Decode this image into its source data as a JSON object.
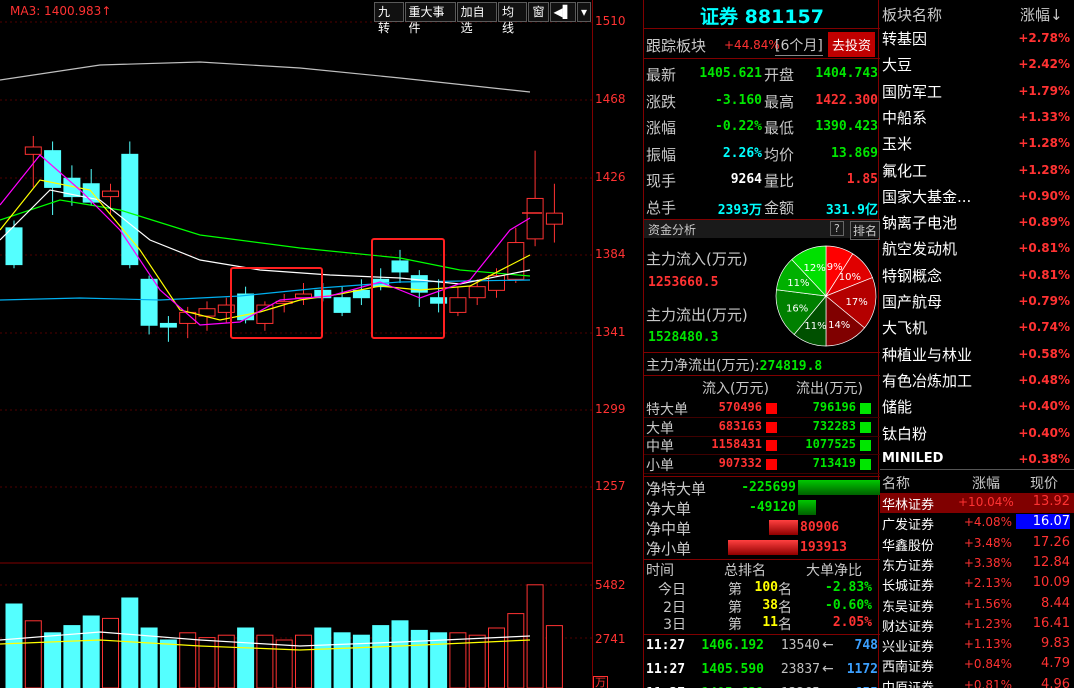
{
  "chart": {
    "ma_label": "MA3: 1400.983",
    "ma_arrow": "↑",
    "toolbar": [
      "九转",
      "重大事件",
      "加自选",
      "均线",
      "窗"
    ],
    "toolbar_icons": [
      "speaker-icon",
      "dropdown-icon"
    ],
    "price_ticks": [
      "1510",
      "1468",
      "1426",
      "1384",
      "1341",
      "1299",
      "1257"
    ],
    "volume_ticks": [
      "5482",
      "2741"
    ],
    "volume_unit": "万",
    "colors": {
      "up": "#ff3232",
      "down": "#54ffff",
      "ma1": "#ffffff",
      "ma2": "#ffff00",
      "ma3": "#ff00ff",
      "ma4": "#00ff00",
      "ma5": "#00b0f0"
    }
  },
  "header": {
    "name": "证券",
    "code": "881157"
  },
  "track": {
    "label": "跟踪板块",
    "pct": "+44.84%",
    "period": "[6个月]",
    "invest_button": "去投资"
  },
  "quote": {
    "rows": [
      {
        "l1": "最新",
        "v1": "1405.621",
        "c1": "green",
        "l2": "开盘",
        "v2": "1404.743",
        "c2": "green"
      },
      {
        "l1": "涨跌",
        "v1": "-3.160",
        "c1": "green",
        "l2": "最高",
        "v2": "1422.300",
        "c2": "red"
      },
      {
        "l1": "涨幅",
        "v1": "-0.22%",
        "c1": "green",
        "l2": "最低",
        "v2": "1390.423",
        "c2": "green"
      },
      {
        "l1": "振幅",
        "v1": "2.26%",
        "c1": "cyan",
        "l2": "均价",
        "v2": "13.869",
        "c2": "green"
      },
      {
        "l1": "现手",
        "v1": "9264",
        "c1": "white",
        "l2": "量比",
        "v2": "1.85",
        "c2": "red"
      },
      {
        "l1": "总手",
        "v1": "2393万",
        "c1": "cyan",
        "l2": "金额",
        "v2": "331.9亿",
        "c2": "cyan"
      }
    ]
  },
  "fund": {
    "title": "资金分析",
    "help": "?",
    "rank": "排名",
    "inflow_label": "主力流入(万元)",
    "inflow_value": "1253660.5",
    "outflow_label": "主力流出(万元)",
    "outflow_value": "1528480.3",
    "net_label": "主力净流出(万元):",
    "net_value": "274819.8",
    "pie": [
      {
        "label": "9%",
        "value": 9,
        "color": "#ff0000"
      },
      {
        "label": "10%",
        "value": 10,
        "color": "#e00000"
      },
      {
        "label": "17%",
        "value": 17,
        "color": "#b40000"
      },
      {
        "label": "14%",
        "value": 14,
        "color": "#800000"
      },
      {
        "label": "11%",
        "value": 11,
        "color": "#005000"
      },
      {
        "label": "16%",
        "value": 16,
        "color": "#008000"
      },
      {
        "label": "11%",
        "value": 11,
        "color": "#00b000"
      },
      {
        "label": "12%",
        "value": 12,
        "color": "#00e000"
      }
    ],
    "table_head": [
      "流入(万元)",
      "流出(万元)"
    ],
    "table": [
      {
        "name": "特大单",
        "in": "570496",
        "out": "796196"
      },
      {
        "name": "大单",
        "in": "683163",
        "out": "732283"
      },
      {
        "name": "中单",
        "in": "1158431",
        "out": "1077525"
      },
      {
        "name": "小单",
        "in": "907332",
        "out": "713419"
      }
    ],
    "net": [
      {
        "name": "净特大单",
        "value": "-225699",
        "v": -225699
      },
      {
        "name": "净大单",
        "value": "-49120",
        "v": -49120
      },
      {
        "name": "净中单",
        "value": "80906",
        "v": 80906
      },
      {
        "name": "净小单",
        "value": "193913",
        "v": 193913
      }
    ]
  },
  "rank": {
    "head": [
      "时间",
      "总排名",
      "大单净比"
    ],
    "rows": [
      {
        "t": "今日",
        "p": "第",
        "n": "100",
        "m": "名",
        "r": "-2.83%",
        "c": "green"
      },
      {
        "t": "2日",
        "p": "第",
        "n": "38",
        "m": "名",
        "r": "-0.60%",
        "c": "green"
      },
      {
        "t": "3日",
        "p": "第",
        "n": "11",
        "m": "名",
        "r": "2.05%",
        "c": "red"
      }
    ]
  },
  "ticks": [
    {
      "time": "11:27",
      "price": "1406.192",
      "vol": "13540",
      "dir": "←",
      "num": "748"
    },
    {
      "time": "11:27",
      "price": "1405.590",
      "vol": "23837",
      "dir": "←",
      "num": "1172"
    },
    {
      "time": "11:27",
      "price": "1405.621",
      "vol": "13265",
      "dir": "←",
      "num": "655"
    }
  ],
  "sectors": {
    "head": [
      "板块名称",
      "涨幅↓"
    ],
    "rows": [
      {
        "name": "转基因",
        "pct": "+2.78%"
      },
      {
        "name": "大豆",
        "pct": "+2.42%"
      },
      {
        "name": "国防军工",
        "pct": "+1.79%"
      },
      {
        "name": "中船系",
        "pct": "+1.33%"
      },
      {
        "name": "玉米",
        "pct": "+1.28%"
      },
      {
        "name": "氟化工",
        "pct": "+1.28%"
      },
      {
        "name": "国家大基金...",
        "pct": "+0.90%"
      },
      {
        "name": "钠离子电池",
        "pct": "+0.89%"
      },
      {
        "name": "航空发动机",
        "pct": "+0.81%"
      },
      {
        "name": "特钢概念",
        "pct": "+0.81%"
      },
      {
        "name": "国产航母",
        "pct": "+0.79%"
      },
      {
        "name": "大飞机",
        "pct": "+0.74%"
      },
      {
        "name": "种植业与林业",
        "pct": "+0.58%"
      },
      {
        "name": "有色冶炼加工",
        "pct": "+0.48%"
      },
      {
        "name": "储能",
        "pct": "+0.40%"
      },
      {
        "name": "钛白粉",
        "pct": "+0.40%"
      },
      {
        "name": "MINILED",
        "pct": "+0.38%"
      }
    ]
  },
  "stocks": {
    "head": [
      "名称",
      "涨幅",
      "现价"
    ],
    "rows": [
      {
        "name": "华林证券",
        "pct": "+10.04%",
        "price": "13.92"
      },
      {
        "name": "广发证券",
        "pct": "+4.08%",
        "price": "16.07"
      },
      {
        "name": "华鑫股份",
        "pct": "+3.48%",
        "price": "17.26"
      },
      {
        "name": "东方证券",
        "pct": "+3.38%",
        "price": "12.84"
      },
      {
        "name": "长城证券",
        "pct": "+2.13%",
        "price": "10.09"
      },
      {
        "name": "东吴证券",
        "pct": "+1.56%",
        "price": "8.44"
      },
      {
        "name": "财达证券",
        "pct": "+1.23%",
        "price": "16.41"
      },
      {
        "name": "兴业证券",
        "pct": "+1.13%",
        "price": "9.83"
      },
      {
        "name": "西南证券",
        "pct": "+0.84%",
        "price": "4.79"
      },
      {
        "name": "中原证券",
        "pct": "+0.81%",
        "price": "4.96"
      }
    ]
  }
}
